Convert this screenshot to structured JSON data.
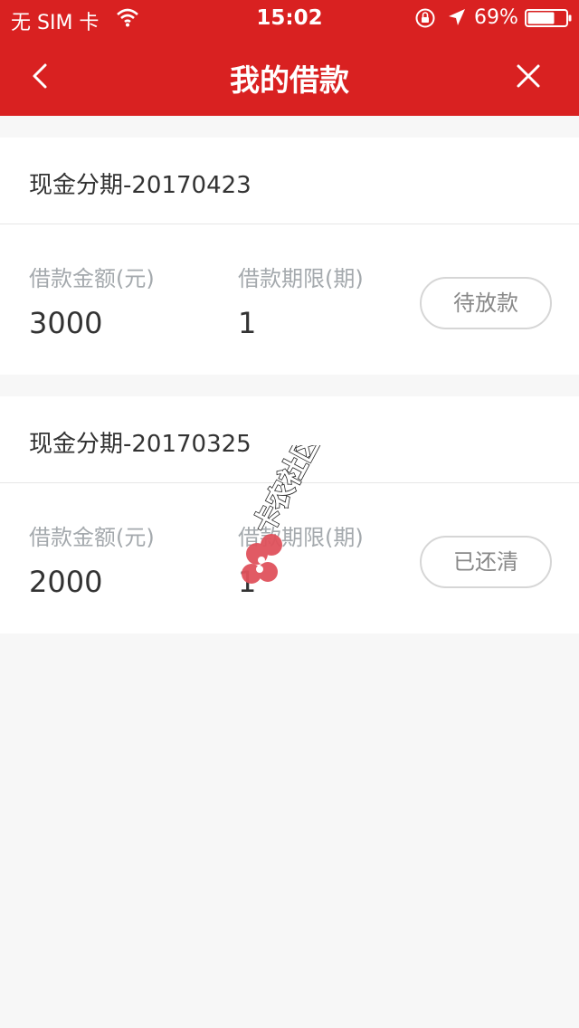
{
  "status_bar": {
    "carrier": "无 SIM 卡",
    "time": "15:02",
    "battery": "69%"
  },
  "nav": {
    "title": "我的借款",
    "back_icon": "chevron-left-icon",
    "close_icon": "close-icon"
  },
  "loans": [
    {
      "name": "现金分期-20170423",
      "amount_label": "借款金额(元)",
      "amount": "3000",
      "term_label": "借款期限(期)",
      "term": "1",
      "status": "待放款"
    },
    {
      "name": "现金分期-20170325",
      "amount_label": "借款金额(元)",
      "amount": "2000",
      "term_label": "借款期限(期)",
      "term": "1",
      "status": "已还清"
    }
  ],
  "watermark": {
    "text": "卡农社区"
  },
  "colors": {
    "header": "#d92121",
    "background": "#f7f7f7",
    "label": "#a4a9ad"
  }
}
